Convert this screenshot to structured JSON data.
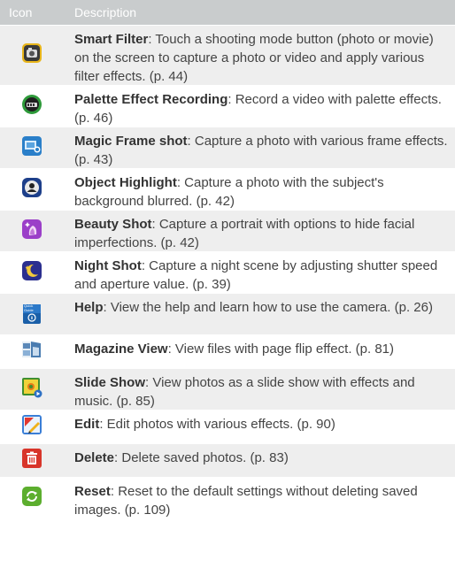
{
  "header": {
    "icon_col": "Icon",
    "desc_col": "Description"
  },
  "rows": [
    {
      "title": "Smart Filter",
      "text": ": Touch a shooting mode button (photo or movie) on the screen to capture a photo or video and apply various filter effects. (p. 44)",
      "icon": "smart-filter-icon"
    },
    {
      "title": "Palette Effect Recording",
      "text": ": Record a video with palette effects. (p. 46)",
      "icon": "palette-effect-icon"
    },
    {
      "title": "Magic Frame shot",
      "text": ": Capture a photo with various frame effects. (p. 43)",
      "icon": "magic-frame-icon"
    },
    {
      "title": "Object Highlight",
      "text": ": Capture a photo with the subject's background blurred. (p. 42)",
      "icon": "object-highlight-icon"
    },
    {
      "title": "Beauty Shot",
      "text": ": Capture a portrait with options to hide facial imperfections. (p. 42)",
      "icon": "beauty-shot-icon"
    },
    {
      "title": "Night Shot",
      "text": ": Capture a night scene by adjusting shutter speed and aperture value. (p. 39)",
      "icon": "night-shot-icon"
    },
    {
      "title": "Help",
      "text": ": View the help and learn how to use the camera. (p. 26)",
      "icon": "help-icon",
      "icon_text": "Quick Guide"
    },
    {
      "title": "Magazine View",
      "text": ": View files with page flip effect. (p. 81)",
      "icon": "magazine-view-icon"
    },
    {
      "title": "Slide Show",
      "text": ": View photos as a slide show with effects and music. (p. 85)",
      "icon": "slide-show-icon"
    },
    {
      "title": "Edit",
      "text": ": Edit photos with various effects. (p. 90)",
      "icon": "edit-icon"
    },
    {
      "title": "Delete",
      "text": ": Delete saved photos. (p. 83)",
      "icon": "delete-icon"
    },
    {
      "title": "Reset",
      "text": ": Reset to the default settings without deleting saved images. (p. 109)",
      "icon": "reset-icon"
    }
  ]
}
